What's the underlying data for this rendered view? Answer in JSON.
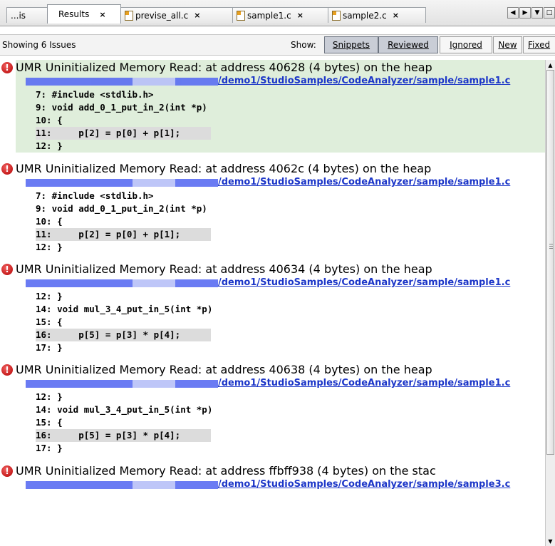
{
  "tabs": [
    {
      "label": "...is",
      "icon": "",
      "active": false,
      "closable": false
    },
    {
      "label": "Results",
      "icon": "",
      "active": true,
      "closable": true
    },
    {
      "label": "previse_all.c",
      "icon": "c-file-icon",
      "active": false,
      "closable": true
    },
    {
      "label": "sample1.c",
      "icon": "c-file-icon",
      "active": false,
      "closable": true
    },
    {
      "label": "sample2.c",
      "icon": "c-file-icon",
      "active": false,
      "closable": true
    }
  ],
  "tab_close_glyph": "×",
  "window_controls": [
    "◀",
    "▶",
    "▼",
    "□"
  ],
  "toolbar": {
    "showing": "Showing 6 Issues",
    "show_label": "Show:",
    "buttons": [
      "Snippets",
      "Reviewed",
      "Ignored",
      "New",
      "Fixed"
    ]
  },
  "issues": [
    {
      "title": "UMR Uninitialized Memory Read: at address 40628 (4 bytes) on the heap",
      "path": "/demo1/StudioSamples/CodeAnalyzer/sample/sample1.c",
      "lines": [
        "7: #include <stdlib.h>",
        "9: void add_0_1_put_in_2(int *p)",
        "10: {",
        "11:     p[2] = p[0] + p[1];",
        "12: }"
      ],
      "highlight": 3
    },
    {
      "title": "UMR Uninitialized Memory Read: at address 4062c (4 bytes) on the heap",
      "path": "/demo1/StudioSamples/CodeAnalyzer/sample/sample1.c",
      "lines": [
        "7: #include <stdlib.h>",
        "9: void add_0_1_put_in_2(int *p)",
        "10: {",
        "11:     p[2] = p[0] + p[1];",
        "12: }"
      ],
      "highlight": 3
    },
    {
      "title": "UMR Uninitialized Memory Read: at address 40634 (4 bytes) on the heap",
      "path": "/demo1/StudioSamples/CodeAnalyzer/sample/sample1.c",
      "lines": [
        "12: }",
        "14: void mul_3_4_put_in_5(int *p)",
        "15: {",
        "16:     p[5] = p[3] * p[4];",
        "17: }"
      ],
      "highlight": 3
    },
    {
      "title": "UMR Uninitialized Memory Read: at address 40638 (4 bytes) on the heap",
      "path": "/demo1/StudioSamples/CodeAnalyzer/sample/sample1.c",
      "lines": [
        "12: }",
        "14: void mul_3_4_put_in_5(int *p)",
        "15: {",
        "16:     p[5] = p[3] * p[4];",
        "17: }"
      ],
      "highlight": 3
    },
    {
      "title": "UMR Uninitialized Memory Read: at address ffbff938 (4 bytes) on the stac",
      "path": "/demo1/StudioSamples/CodeAnalyzer/sample/sample3.c",
      "lines": [],
      "highlight": -1
    }
  ],
  "colors": {
    "link": "#1c36c8",
    "error": "#c00000",
    "selected_issue_bg": "#dfeedb"
  }
}
